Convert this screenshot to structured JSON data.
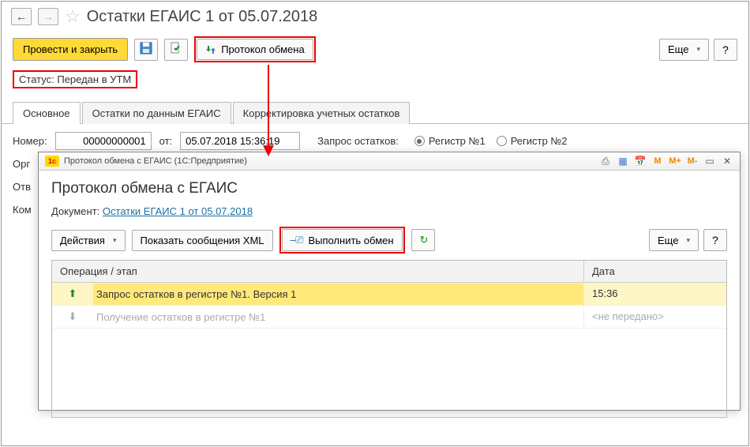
{
  "header": {
    "title": "Остатки ЕГАИС 1 от 05.07.2018"
  },
  "toolbar": {
    "save_close": "Провести и закрыть",
    "protocol": "Протокол обмена",
    "more": "Еще"
  },
  "status": {
    "label": "Статус:",
    "value": "Передан в УТМ"
  },
  "tabs": {
    "main": "Основное",
    "t2": "Остатки по данным ЕГАИС",
    "t3": "Корректировка учетных остатков"
  },
  "fields": {
    "number_label": "Номер:",
    "number_value": "00000000001",
    "ot": "от:",
    "date_value": "05.07.2018 15:36:19",
    "request_label": "Запрос остатков:",
    "reg1": "Регистр №1",
    "reg2": "Регистр №2"
  },
  "trunc": {
    "org": "Орг",
    "otv": "Отв",
    "kom": "Ком"
  },
  "dialog": {
    "window_title": "Протокол обмена с ЕГАИС  (1С:Предприятие)",
    "heading": "Протокол обмена с ЕГАИС",
    "doc_label": "Документ:",
    "doc_link": "Остатки ЕГАИС 1 от 05.07.2018",
    "actions": "Действия",
    "show_xml": "Показать сообщения XML",
    "exec": "Выполнить обмен",
    "more": "Еще",
    "grid": {
      "col_op": "Операция / этап",
      "col_date": "Дата",
      "rows": [
        {
          "dir": "up",
          "text": "Запрос остатков в регистре №1. Версия 1",
          "date": "15:36",
          "sel": true
        },
        {
          "dir": "down",
          "text": "Получение остатков в регистре №1",
          "date": "<не передано>",
          "dim": true
        }
      ]
    }
  }
}
